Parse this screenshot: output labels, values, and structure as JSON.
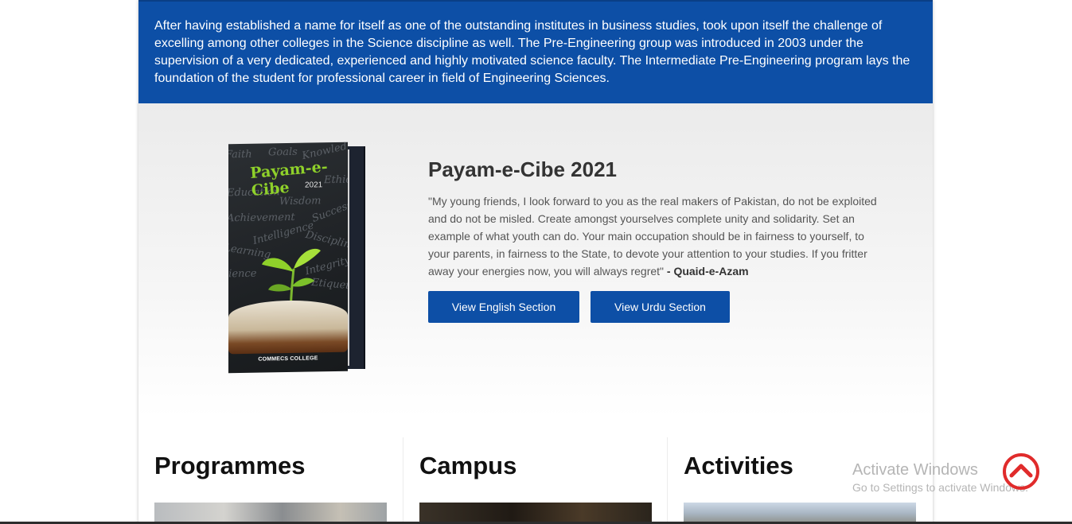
{
  "intro": {
    "text": "After having established a name for itself as one of the outstanding institutes in business studies, took upon itself the challenge of excelling among other colleges in the Science discipline as well. The Pre-Engineering group was introduced in 2003 under the supervision of a very dedicated, experienced and highly motivated science faculty. The Intermediate Pre-Engineering program lays the foundation of the student for professional career in field of Engineering Sciences."
  },
  "payam": {
    "title": "Payam-e-Cibe 2021",
    "quote": "\"My young friends, I look forward to you as the real makers of Pakistan, do not be exploited and do not be misled. Create amongst yourselves complete unity and solidarity. Set an example of what youth can do. Your main occupation should be in fairness to yourself, to your parents, in fairness to the State, to devote your attention to your studies. If you fritter away your energies now, you will always regret\"",
    "quote_author": "- Quaid-e-Azam",
    "english_button": "View English Section",
    "urdu_button": "View Urdu Section",
    "cover": {
      "title": "Payam-e-Cibe",
      "year": "2021",
      "college": "COMMECS COLLEGE",
      "words": [
        "Faith",
        "Goals",
        "Knowledge",
        "Ethics",
        "Education",
        "Wisdom",
        "Achievement",
        "Success",
        "Intelligence",
        "Discipline",
        "Learning",
        "Integrity",
        "Science",
        "Etiquettes"
      ]
    }
  },
  "sections": {
    "programmes": "Programmes",
    "campus": "Campus",
    "activities": "Activities"
  },
  "watermark": {
    "line1": "Activate Windows",
    "line2": "Go to Settings to activate Windows."
  },
  "colors": {
    "brand_blue": "#0d4fa6",
    "scroll_top_red": "#e02b2b"
  }
}
